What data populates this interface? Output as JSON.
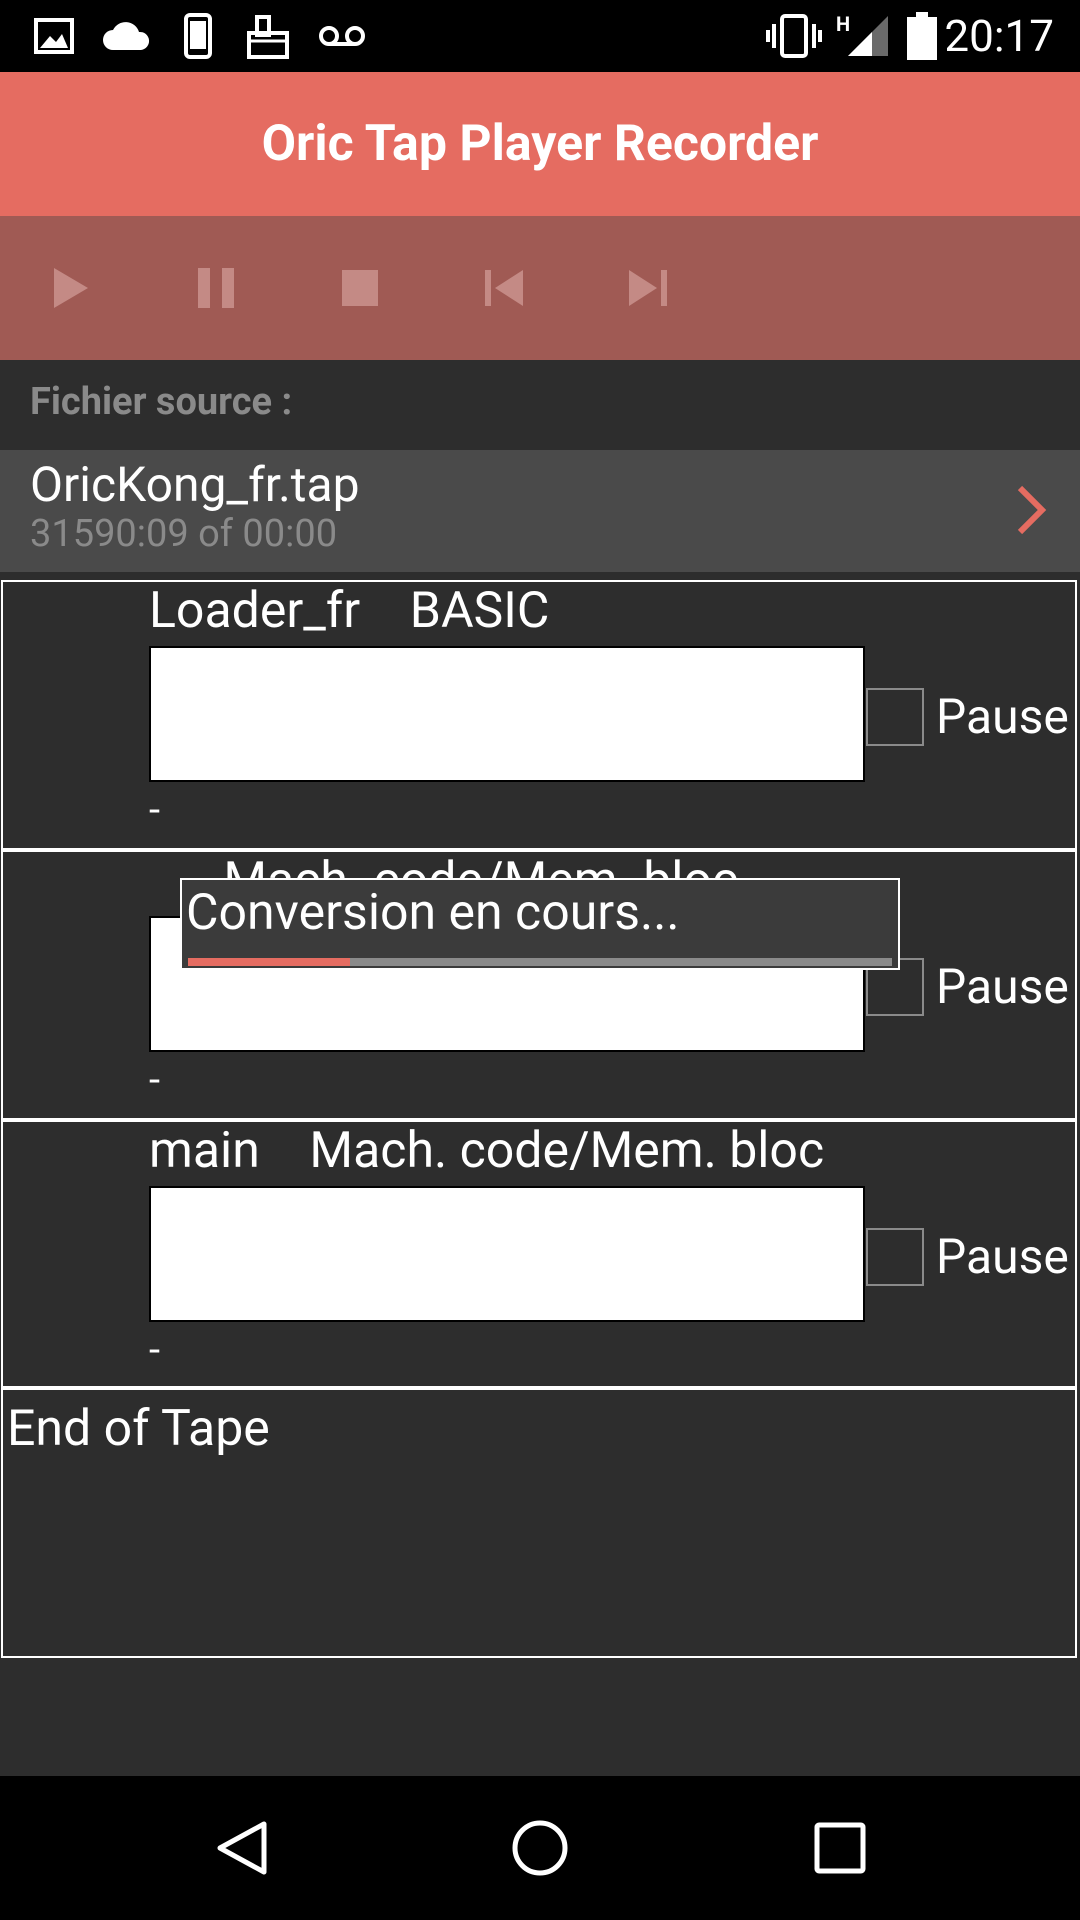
{
  "status_bar": {
    "time": "20:17",
    "network": "H",
    "left_icons": [
      "image-icon",
      "cloud-icon",
      "phone-icon",
      "paint-icon",
      "voicemail-icon"
    ],
    "right_icons": [
      "vibrate-icon",
      "signal-icon",
      "battery-icon"
    ]
  },
  "app": {
    "title": "Oric Tap Player  Recorder"
  },
  "transport": {
    "buttons": [
      "play-icon",
      "pause-icon",
      "stop-icon",
      "skip-previous-icon",
      "skip-next-icon"
    ]
  },
  "source": {
    "label": "Fichier source :",
    "file_name": "OricKong_fr.tap",
    "file_time": "31590:09 of 00:00"
  },
  "blocks": [
    {
      "title": "Loader_fr    BASIC",
      "dash": "-",
      "pause_label": "Pause",
      "pause_checked": false
    },
    {
      "title": "      Mach. code/Mem. bloc",
      "dash": "-",
      "pause_label": "Pause",
      "pause_checked": false
    },
    {
      "title": "main    Mach. code/Mem. bloc",
      "dash": "-",
      "pause_label": "Pause",
      "pause_checked": false
    }
  ],
  "end_of_tape": "End of Tape",
  "dialog": {
    "message": "Conversion en cours...",
    "progress": 0.23
  },
  "colors": {
    "accent": "#e56c61",
    "transport_bg": "#a05a54",
    "background": "#2d2d2d"
  },
  "nav_bar": {
    "buttons": [
      "back-icon",
      "home-icon",
      "recents-icon"
    ]
  }
}
